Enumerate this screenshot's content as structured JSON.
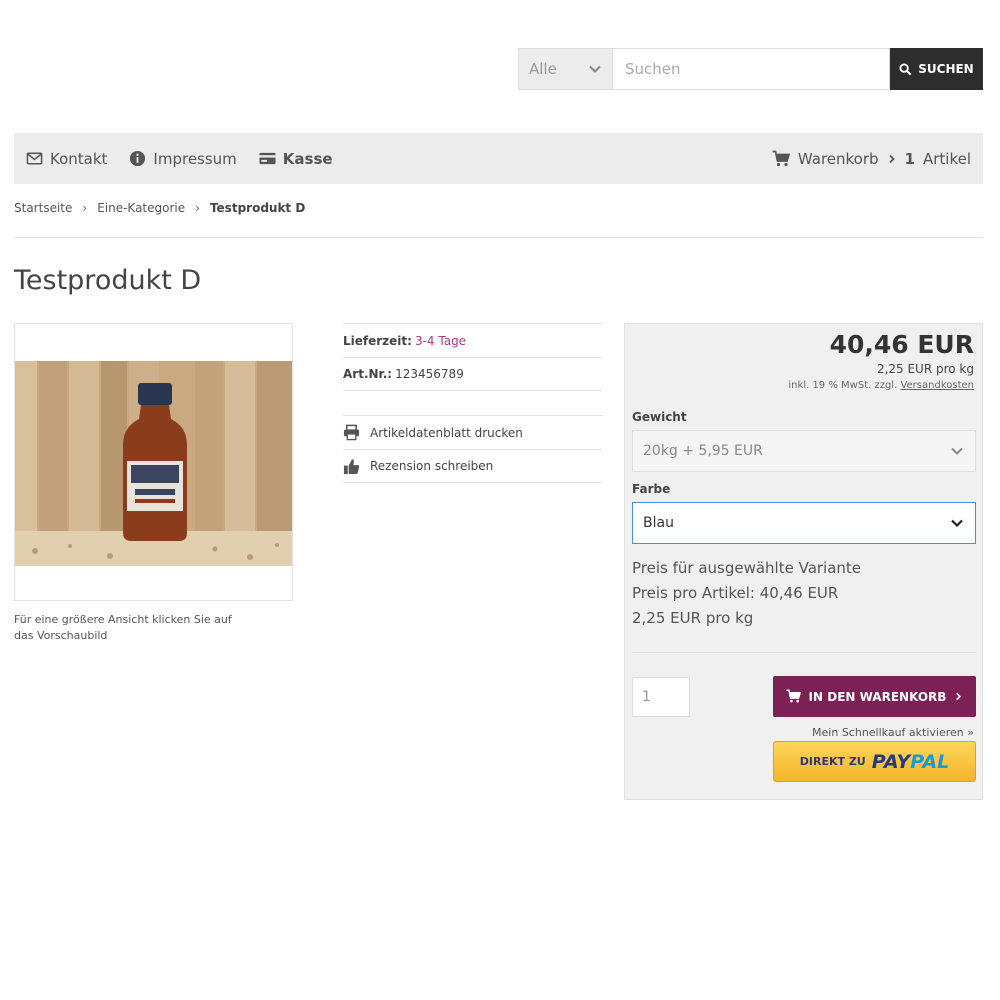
{
  "search": {
    "category": "Alle",
    "placeholder": "Suchen",
    "button": "SUCHEN"
  },
  "nav": {
    "contact": "Kontakt",
    "imprint": "Impressum",
    "checkout": "Kasse",
    "cart_label": "Warenkorb",
    "cart_count": "1",
    "cart_unit": "Artikel"
  },
  "breadcrumb": [
    "Startseite",
    "Eine-Kategorie",
    "Testprodukt D"
  ],
  "product": {
    "title": "Testprodukt D",
    "image_caption": "Für eine größere Ansicht klicken Sie auf das Vorschaubild",
    "delivery_label": "Lieferzeit:",
    "delivery_value": "3-4 Tage",
    "sku_label": "Art.Nr.:",
    "sku_value": "123456789",
    "print_label": "Artikeldatenblatt drucken",
    "review_label": "Rezension schreiben"
  },
  "buy": {
    "price": "40,46 EUR",
    "per_unit": "2,25 EUR pro kg",
    "tax_text": "inkl. 19 % MwSt. zzgl.",
    "shipping_link": "Versandkosten",
    "weight_label": "Gewicht",
    "weight_value": "20kg + 5,95 EUR",
    "color_label": "Farbe",
    "color_value": "Blau",
    "variant_line1": "Preis für ausgewählte Variante",
    "variant_line2": "Preis pro Artikel: 40,46 EUR",
    "variant_line3": "2,25 EUR pro kg",
    "quantity": "1",
    "add_to_cart": "IN DEN WARENKORB",
    "quick_buy": "Mein Schnellkauf aktivieren »",
    "paypal_prefix": "DIREKT ZU",
    "paypal_pay": "PAY",
    "paypal_pal": "PAL"
  },
  "colors": {
    "accent": "#7b2156",
    "pink_text": "#b03a7a",
    "dark_button": "#2d2d2d",
    "bar_bg": "#ececec"
  }
}
